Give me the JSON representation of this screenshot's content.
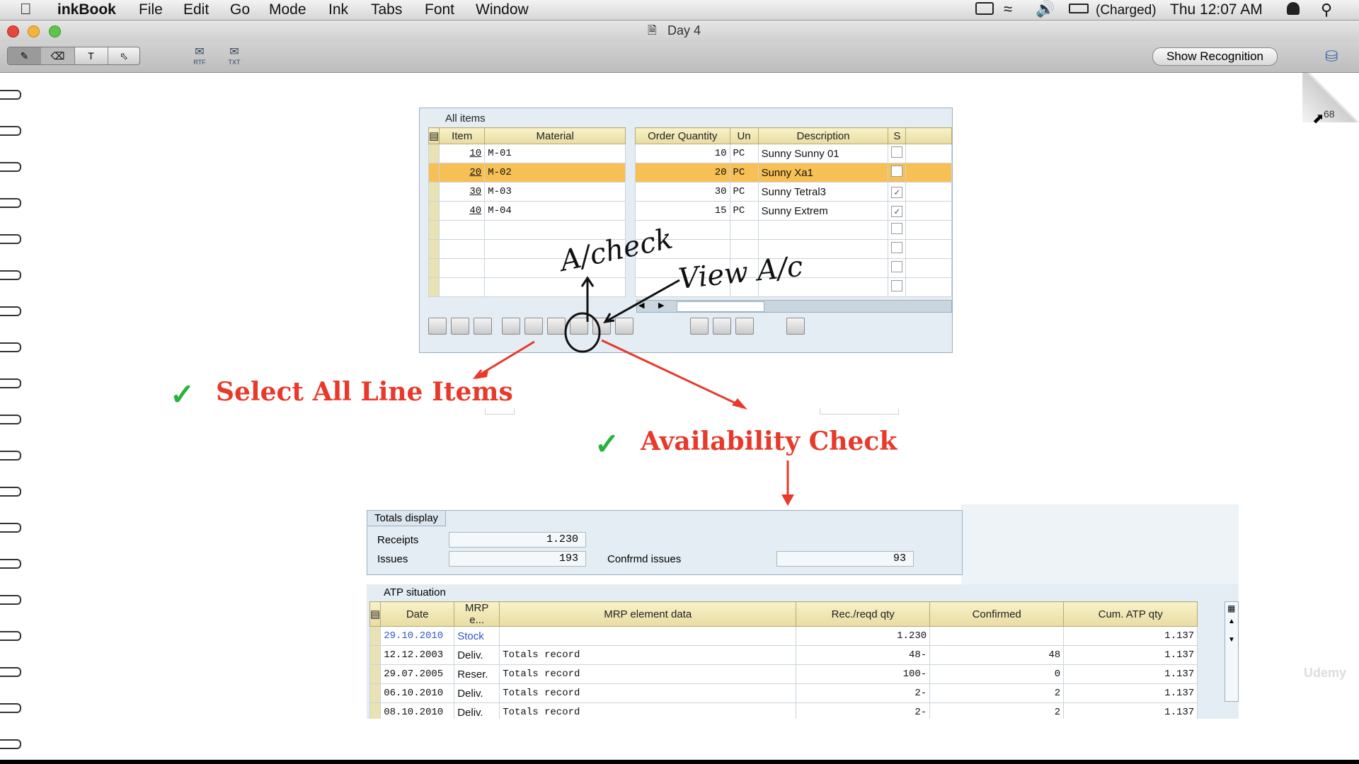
{
  "menubar": {
    "app": "inkBook",
    "menus": [
      "File",
      "Edit",
      "Go",
      "Mode",
      "Ink",
      "Tabs",
      "Font",
      "Window"
    ],
    "battery": "(Charged)",
    "clock": "Thu 12:07 AM"
  },
  "window": {
    "title": "Day 4"
  },
  "toolbar": {
    "show_recognition": "Show Recognition",
    "tool_T": "T",
    "icon_rtf": "RTF",
    "icon_txt": "TXT"
  },
  "page_number": "68",
  "items_panel": {
    "title": "All items",
    "left_headers": [
      "Item",
      "Material"
    ],
    "right_headers": [
      "Order Quantity",
      "Un",
      "Description",
      "S"
    ],
    "rows": [
      {
        "item": "10",
        "material": "M-01",
        "qty": "10",
        "un": "PC",
        "desc": "Sunny Sunny 01",
        "s": ""
      },
      {
        "item": "20",
        "material": "M-02",
        "qty": "20",
        "un": "PC",
        "desc": "Sunny Xa1",
        "s": ""
      },
      {
        "item": "30",
        "material": "M-03",
        "qty": "30",
        "un": "PC",
        "desc": "Sunny Tetral3",
        "s": "✓"
      },
      {
        "item": "40",
        "material": "M-04",
        "qty": "15",
        "un": "PC",
        "desc": "Sunny Extrem",
        "s": "✓"
      }
    ]
  },
  "handwriting": {
    "a": "A/check",
    "b": "View A/c"
  },
  "annotations": {
    "select_all": "Select All Line Items",
    "availability": "Availability Check",
    "check": "✓"
  },
  "totals": {
    "tab": "Totals display",
    "receipts_label": "Receipts",
    "receipts": "1.230",
    "issues_label": "Issues",
    "issues": "193",
    "confirmed_label": "Confrmd issues",
    "confirmed": "93"
  },
  "atp": {
    "title": "ATP situation",
    "headers": [
      "Date",
      "MRP e...",
      "MRP element data",
      "Rec./reqd qty",
      "Confirmed",
      "Cum. ATP qty"
    ],
    "rows": [
      {
        "date": "29.10.2010",
        "mrp": "Stock",
        "data": "",
        "qty": "1.230",
        "conf": "",
        "cum": "1.137"
      },
      {
        "date": "12.12.2003",
        "mrp": "Deliv.",
        "data": "Totals record",
        "qty": "48-",
        "conf": "48",
        "cum": "1.137"
      },
      {
        "date": "29.07.2005",
        "mrp": "Reser.",
        "data": "Totals record",
        "qty": "100-",
        "conf": "0",
        "cum": "1.137"
      },
      {
        "date": "06.10.2010",
        "mrp": "Deliv.",
        "data": "Totals record",
        "qty": "2-",
        "conf": "2",
        "cum": "1.137"
      },
      {
        "date": "08.10.2010",
        "mrp": "Deliv.",
        "data": "Totals record",
        "qty": "2-",
        "conf": "2",
        "cum": "1.137"
      }
    ]
  },
  "watermark": "Udemy"
}
